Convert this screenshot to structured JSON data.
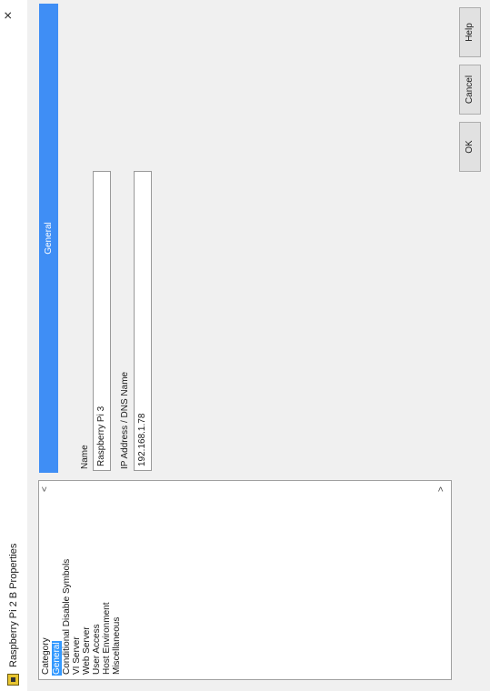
{
  "window": {
    "title": "Raspberry Pi 2 B Properties",
    "close_label": "×"
  },
  "category": {
    "header": "Category",
    "items": [
      {
        "label": "General",
        "selected": true
      },
      {
        "label": "Conditional Disable Symbols"
      },
      {
        "label": "VI Server"
      },
      {
        "label": "Web Server"
      },
      {
        "label": "User Access"
      },
      {
        "label": "Host Environment"
      },
      {
        "label": "Miscellaneous"
      }
    ],
    "scroll_left": "<",
    "scroll_right": ">"
  },
  "general": {
    "header": "General",
    "name_label": "Name",
    "name_value": "Raspberry Pi 3",
    "ip_label": "IP Address / DNS Name",
    "ip_value": "192.168.1.78"
  },
  "buttons": {
    "ok": "OK",
    "cancel": "Cancel",
    "help": "Help"
  },
  "colors": {
    "accent": "#3f8ef5",
    "selection": "#3399ff"
  }
}
